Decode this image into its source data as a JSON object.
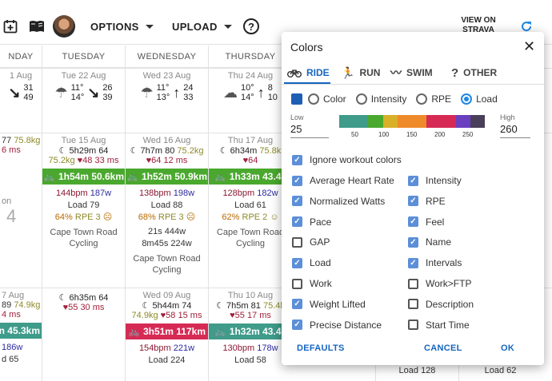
{
  "toolbar": {
    "options_label": "OPTIONS",
    "upload_label": "UPLOAD",
    "help_label": "?",
    "strava_line1": "VIEW ON",
    "strava_line2": "STRAVA"
  },
  "calendar": {
    "day_headers": [
      "NDAY",
      "TUESDAY",
      "WEDNESDAY",
      "THURSDAY"
    ],
    "weather": [
      {
        "date": "1 Aug",
        "lo": "",
        "hi": "31",
        "hi2": "49"
      },
      {
        "date": "Tue 22 Aug",
        "t1": "11°",
        "t2": "14°",
        "w1": "26",
        "w2": "39"
      },
      {
        "date": "Wed 23 Aug",
        "t1": "11°",
        "t2": "13°",
        "w1": "24",
        "w2": "33"
      },
      {
        "date": "Thu 24 Aug",
        "t1": "10°",
        "t2": "14°",
        "w1": "8",
        "w2": "10"
      }
    ],
    "week2": {
      "mon": {
        "v1": "77",
        "wt": "75.8kg",
        "hrv": "6 ms",
        "lbl": "on",
        "num": "4"
      },
      "tue": {
        "date": "Tue 15 Aug",
        "sleep": "5h29m",
        "score": "64",
        "wt": "75.2kg",
        "hrv": "48",
        "ms": "33 ms",
        "bar": "1h54m 50.6km",
        "bpm": "144bpm",
        "w": "187w",
        "load": "Load 79",
        "pct": "64%",
        "rpe": "RPE 3",
        "loc1": "Cape Town Road",
        "loc2": "Cycling"
      },
      "wed": {
        "date": "Wed 16 Aug",
        "sleep": "7h7m",
        "score": "80",
        "wt": "75.2kg",
        "hrv": "64",
        "ms": "12 ms",
        "bar": "1h52m 50.9km",
        "bpm": "138bpm",
        "w": "198w",
        "load": "Load 88",
        "pct": "68%",
        "rpe": "RPE 3",
        "extra1": "21s 444w",
        "extra2": "8m45s 224w",
        "loc1": "Cape Town Road",
        "loc2": "Cycling"
      },
      "thu": {
        "date": "Thu 17 Aug",
        "sleep": "6h34m",
        "wt": "75.8k",
        "hrv": "64",
        "bar": "1h33m 43.4k",
        "bpm": "128bpm",
        "w": "182w",
        "load": "Load 61",
        "pct": "62%",
        "rpe": "RPE 2",
        "loc1": "Cape Town Road",
        "loc2": "Cycling"
      }
    },
    "week3": {
      "mon": {
        "v1": "7 Aug",
        "v2": "89",
        "wt": "74.9kg",
        "hrv": "4 ms",
        "bar": "n 45.3km",
        "bpm": "186w",
        "load": "d 65"
      },
      "tue": {
        "sleep": "6h35m",
        "score": "64",
        "hrv": "55",
        "ms": "30 ms"
      },
      "wed": {
        "date": "Wed 09 Aug",
        "sleep": "5h44m",
        "score": "74",
        "wt": "74.9kg",
        "hrv": "58",
        "ms": "15 ms",
        "bar": "3h51m 117km",
        "bpm": "154bpm",
        "w": "221w",
        "load": "Load 224"
      },
      "thu": {
        "date": "Thu 10 Aug",
        "sleep": "7h5m",
        "score": "81",
        "wt": "75.4k",
        "hrv": "55",
        "ms": "17 ms",
        "bar": "1h32m 43.4k",
        "bpm": "130bpm",
        "w": "178w",
        "load": "Load 58"
      },
      "fri": {
        "load": "Load 128"
      },
      "sat": {
        "load": "Load 62"
      }
    }
  },
  "dialog": {
    "title": "Colors",
    "tabs": [
      {
        "label": "RIDE",
        "icon": "bike-icon"
      },
      {
        "label": "RUN",
        "icon": "run-icon"
      },
      {
        "label": "SWIM",
        "icon": "swim-icon"
      },
      {
        "label": "OTHER",
        "icon": "question-icon"
      }
    ],
    "color_modes": [
      "Color",
      "Intensity",
      "RPE",
      "Load"
    ],
    "selected_mode": "Load",
    "low_label": "Low",
    "low_value": "25",
    "high_label": "High",
    "high_value": "260",
    "scale_ticks": [
      "50",
      "100",
      "150",
      "200",
      "250"
    ],
    "scale_colors": [
      "#3f9b8a",
      "#3f9b8a",
      "#4aa82e",
      "#d9b02a",
      "#ef8a2a",
      "#ef8a2a",
      "#d62a55",
      "#d62a55",
      "#6a3fc0",
      "#4a3f5a"
    ],
    "ignore_label": "Ignore workout colors",
    "left_options": [
      {
        "label": "Average Heart Rate",
        "checked": true
      },
      {
        "label": "Normalized Watts",
        "checked": true
      },
      {
        "label": "Pace",
        "checked": true
      },
      {
        "label": "GAP",
        "checked": false
      },
      {
        "label": "Load",
        "checked": true
      },
      {
        "label": "Work",
        "checked": false
      },
      {
        "label": "Weight Lifted",
        "checked": true
      },
      {
        "label": "Precise Distance",
        "checked": true
      }
    ],
    "right_options": [
      {
        "label": "Intensity",
        "checked": true
      },
      {
        "label": "RPE",
        "checked": true
      },
      {
        "label": "Feel",
        "checked": true
      },
      {
        "label": "Name",
        "checked": true
      },
      {
        "label": "Intervals",
        "checked": true
      },
      {
        "label": "Work>FTP",
        "checked": false
      },
      {
        "label": "Description",
        "checked": false
      },
      {
        "label": "Start Time",
        "checked": false
      }
    ],
    "defaults_label": "DEFAULTS",
    "cancel_label": "CANCEL",
    "ok_label": "OK"
  }
}
